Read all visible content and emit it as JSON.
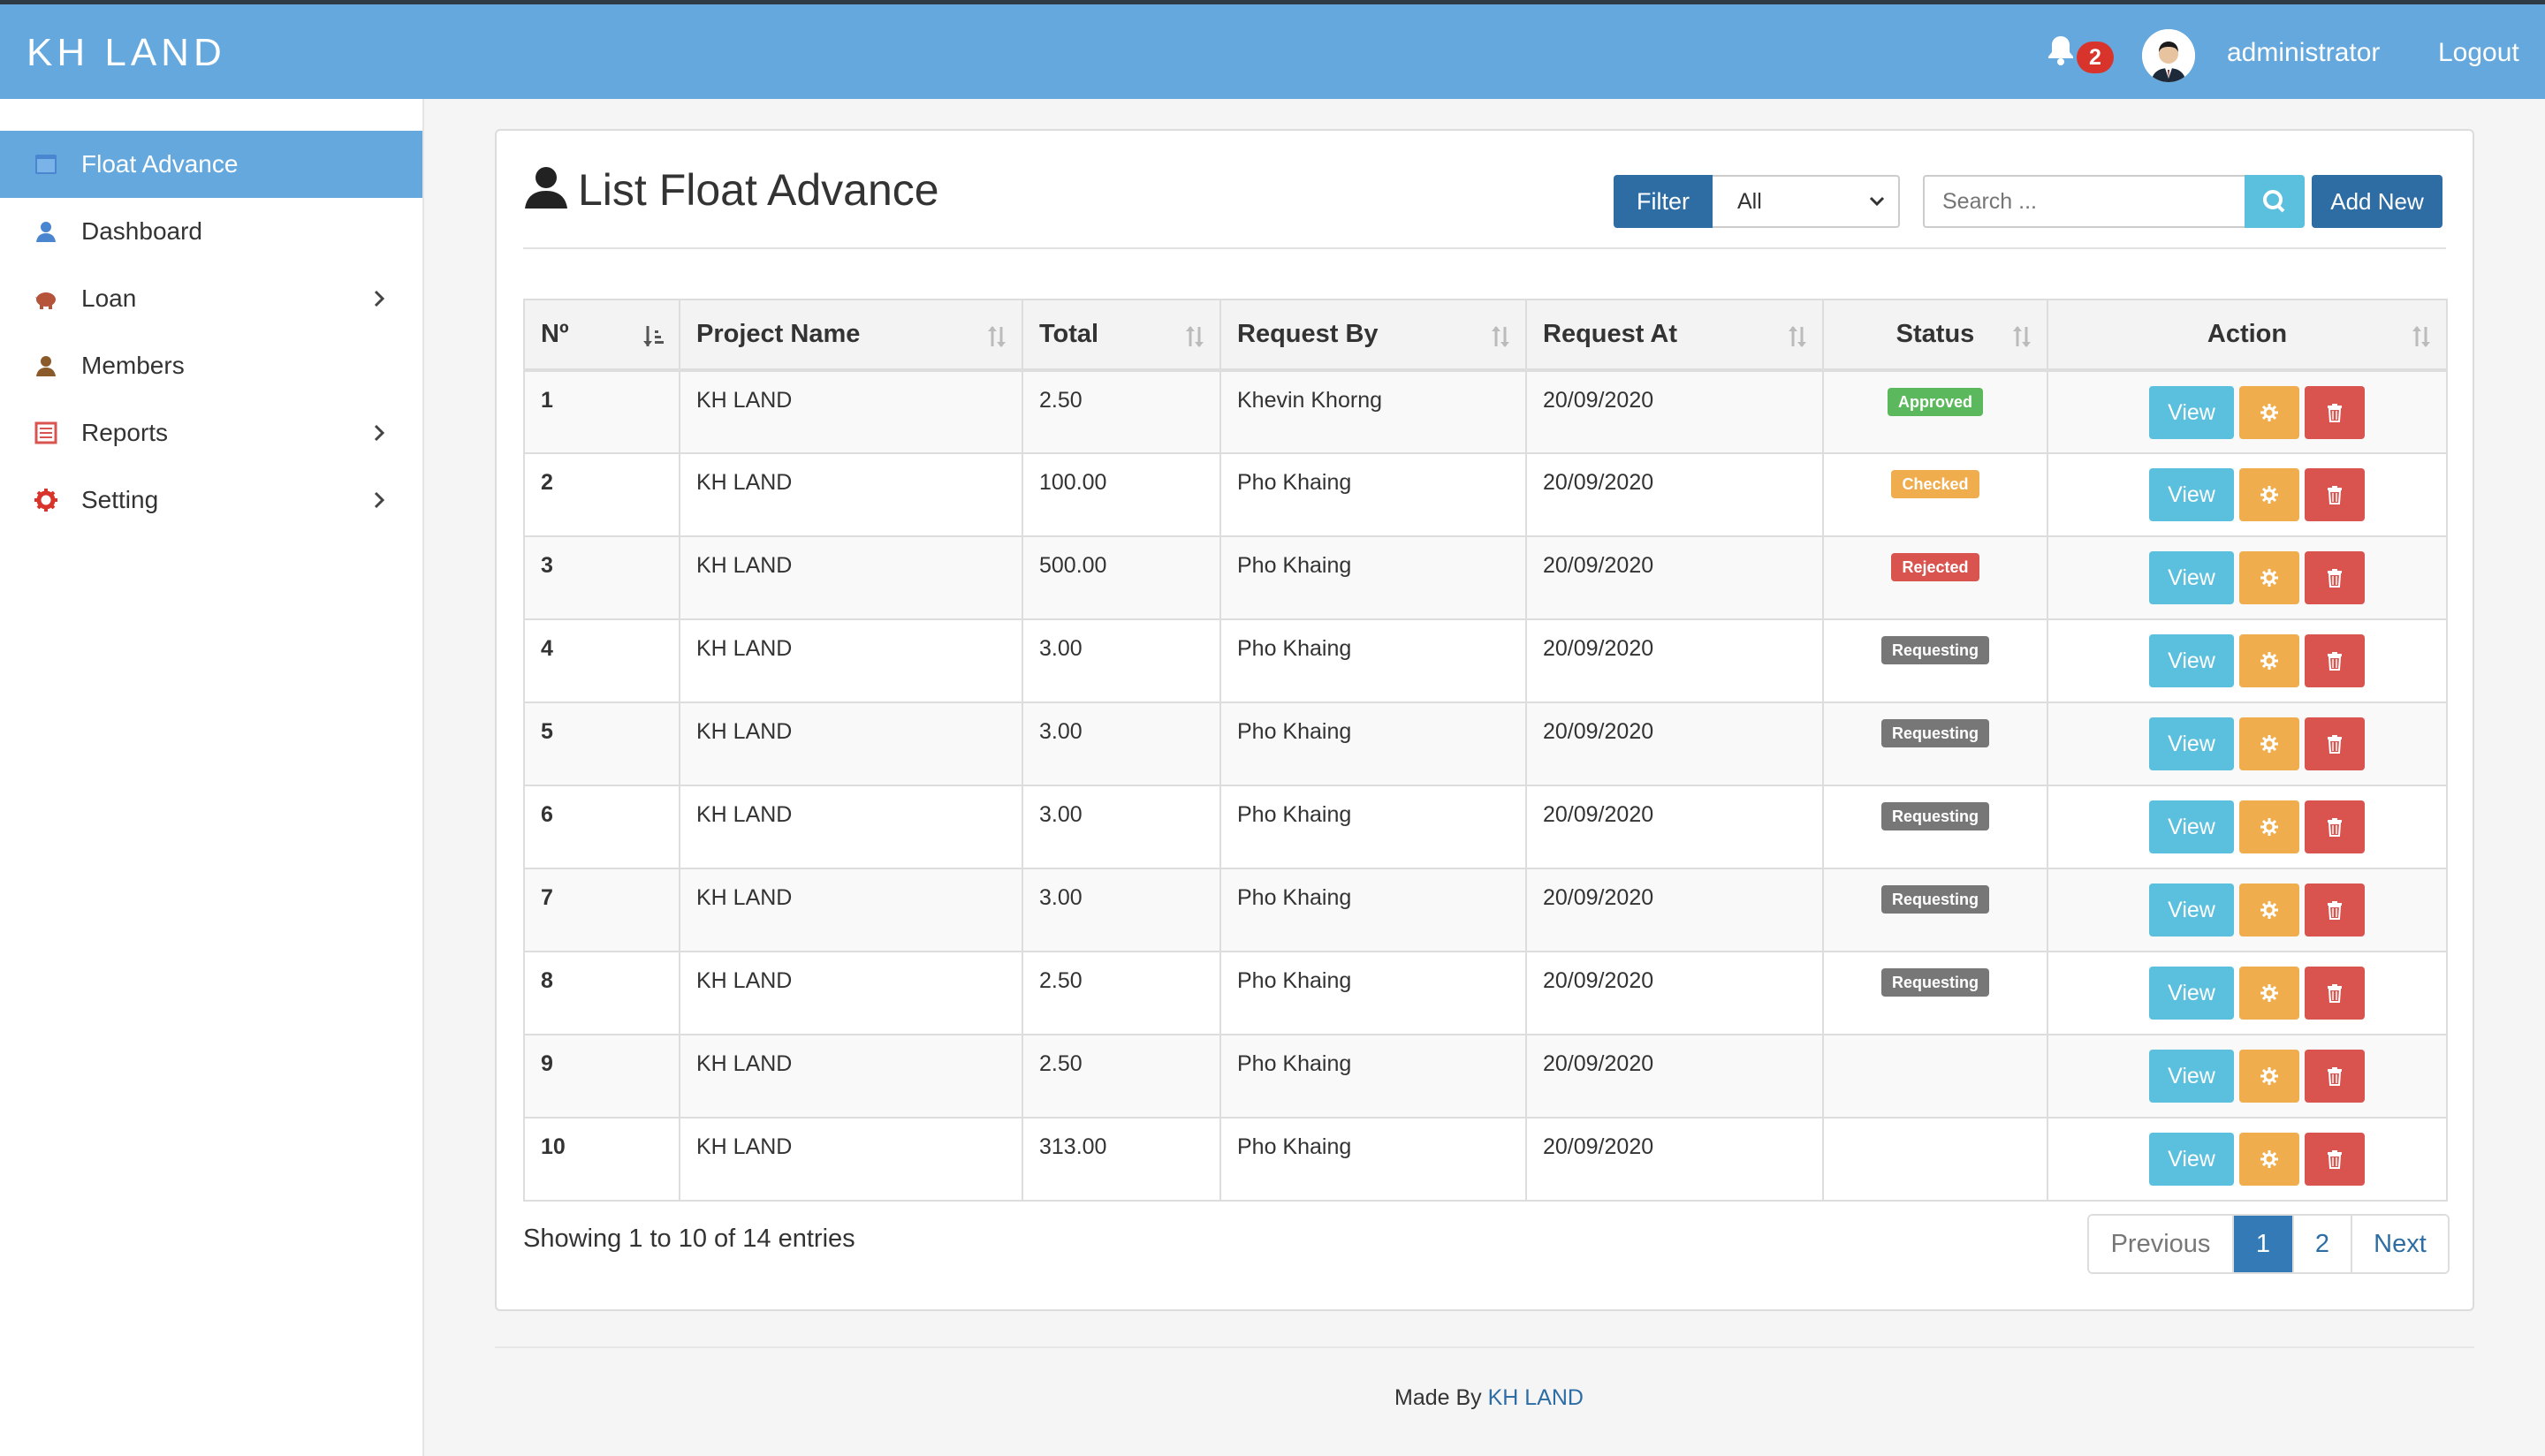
{
  "app": {
    "brand": "KH LAND",
    "notifications_count": "2",
    "user_name": "administrator",
    "logout_label": "Logout"
  },
  "sidebar": {
    "items": [
      {
        "label": "Float Advance",
        "icon": "table-icon",
        "active": true,
        "has_children": false
      },
      {
        "label": "Dashboard",
        "icon": "user-icon",
        "active": false,
        "has_children": false
      },
      {
        "label": "Loan",
        "icon": "piggy-bank-icon",
        "active": false,
        "has_children": true
      },
      {
        "label": "Members",
        "icon": "user-icon",
        "active": false,
        "has_children": false
      },
      {
        "label": "Reports",
        "icon": "list-alt-icon",
        "active": false,
        "has_children": true
      },
      {
        "label": "Setting",
        "icon": "gear-icon",
        "active": false,
        "has_children": true
      }
    ]
  },
  "main": {
    "title": "List Float Advance",
    "filter_label": "Filter",
    "filter_value": "All",
    "search_placeholder": "Search ...",
    "add_new_label": "Add New"
  },
  "table": {
    "columns": [
      "Nº",
      "Project Name",
      "Total",
      "Request By",
      "Request At",
      "Status",
      "Action"
    ],
    "rows": [
      {
        "no": "1",
        "project": "KH LAND",
        "total": "2.50",
        "request_by": "Khevin Khorng",
        "request_at": "20/09/2020",
        "status": "Approved"
      },
      {
        "no": "2",
        "project": "KH LAND",
        "total": "100.00",
        "request_by": "Pho Khaing",
        "request_at": "20/09/2020",
        "status": "Checked"
      },
      {
        "no": "3",
        "project": "KH LAND",
        "total": "500.00",
        "request_by": "Pho Khaing",
        "request_at": "20/09/2020",
        "status": "Rejected"
      },
      {
        "no": "4",
        "project": "KH LAND",
        "total": "3.00",
        "request_by": "Pho Khaing",
        "request_at": "20/09/2020",
        "status": "Requesting"
      },
      {
        "no": "5",
        "project": "KH LAND",
        "total": "3.00",
        "request_by": "Pho Khaing",
        "request_at": "20/09/2020",
        "status": "Requesting"
      },
      {
        "no": "6",
        "project": "KH LAND",
        "total": "3.00",
        "request_by": "Pho Khaing",
        "request_at": "20/09/2020",
        "status": "Requesting"
      },
      {
        "no": "7",
        "project": "KH LAND",
        "total": "3.00",
        "request_by": "Pho Khaing",
        "request_at": "20/09/2020",
        "status": "Requesting"
      },
      {
        "no": "8",
        "project": "KH LAND",
        "total": "2.50",
        "request_by": "Pho Khaing",
        "request_at": "20/09/2020",
        "status": "Requesting"
      },
      {
        "no": "9",
        "project": "KH LAND",
        "total": "2.50",
        "request_by": "Pho Khaing",
        "request_at": "20/09/2020",
        "status": ""
      },
      {
        "no": "10",
        "project": "KH LAND",
        "total": "313.00",
        "request_by": "Pho Khaing",
        "request_at": "20/09/2020",
        "status": ""
      }
    ],
    "view_label": "View",
    "status_colors": {
      "Approved": "#5cb85c",
      "Checked": "#f0ad4e",
      "Rejected": "#d9534f",
      "Requesting": "#777777"
    }
  },
  "pagination": {
    "info": "Showing 1 to 10 of 14 entries",
    "previous": "Previous",
    "pages": [
      "1",
      "2"
    ],
    "current": "1",
    "next": "Next"
  },
  "footer": {
    "prefix": "Made By",
    "link": "KH LAND"
  },
  "colors": {
    "header": "#64a8dd",
    "primary": "#2e6da4",
    "info": "#5bc0de"
  }
}
